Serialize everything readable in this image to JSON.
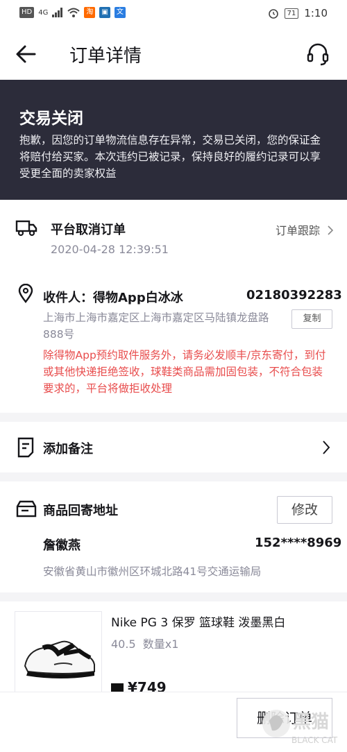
{
  "status_bar": {
    "left_icons": [
      "HD",
      "4G",
      "signal-icon",
      "wifi-icon",
      "taobao-icon",
      "app-icon",
      "translate-icon"
    ],
    "battery": "71",
    "time": "1:10"
  },
  "header": {
    "title": "订单详情",
    "back_icon": "arrow-left-icon",
    "service_icon": "headset-icon"
  },
  "banner": {
    "title": "交易关闭",
    "message": "抱歉，因您的订单物流信息存在异常，交易已关闭，您的保证金将赔付给买家。本次违约已被记录，保持良好的履约记录可以享受更全面的卖家权益"
  },
  "tracking": {
    "status": "平台取消订单",
    "time": "2020-04-28 12:39:51",
    "link_label": "订单跟踪"
  },
  "recipient": {
    "label": "收件人：得物App白冰冰",
    "phone": "02180392283",
    "address": "上海市上海市嘉定区上海市嘉定区马陆镇龙盘路888号",
    "copy_label": "复制",
    "notice": "除得物App预约取件服务外，请务必发顺丰/京东寄付，到付或其他快递拒绝签收，球鞋类商品需加固包装，不符合包装要求的，平台将做拒收处理"
  },
  "remark": {
    "label": "添加备注"
  },
  "return_address": {
    "title": "商品回寄地址",
    "edit_label": "修改",
    "name": "詹徽燕",
    "phone": "152****8969",
    "address": "安徽省黄山市徽州区环城北路41号交通运输局"
  },
  "product": {
    "name": "Nike PG 3 保罗 篮球鞋 泼墨黑白",
    "spec": "40.5  数量x1",
    "price": "¥749"
  },
  "actions": {
    "delete_label": "删除订单"
  },
  "watermark": {
    "text": "黑猫",
    "sub": "BLACK CAT"
  },
  "colors": {
    "banner_bg": "#2c2c3a",
    "notice_red": "#e84c4c",
    "page_bg": "#f4f4f6"
  }
}
